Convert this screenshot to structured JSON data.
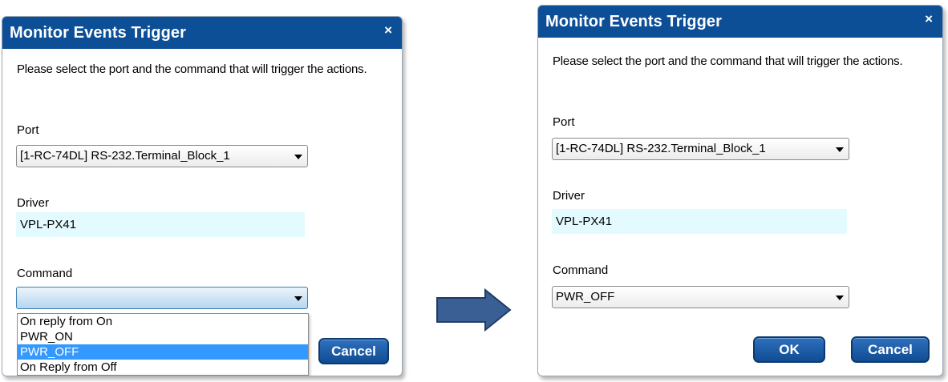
{
  "left_dialog": {
    "title": "Monitor Events Trigger",
    "close_glyph": "×",
    "description": "Please select the port and the command that will trigger the actions.",
    "port_label": "Port",
    "port_value": "[1-RC-74DL] RS-232.Terminal_Block_1",
    "driver_label": "Driver",
    "driver_value": "VPL-PX41",
    "command_label": "Command",
    "command_value": "",
    "command_options": [
      "On reply from On",
      "PWR_ON",
      "PWR_OFF",
      "On Reply from Off"
    ],
    "command_highlighted": "PWR_OFF",
    "cancel_label": "Cancel"
  },
  "right_dialog": {
    "title": "Monitor Events Trigger",
    "close_glyph": "×",
    "description": "Please select the port and the command that will trigger the actions.",
    "port_label": "Port",
    "port_value": "[1-RC-74DL] RS-232.Terminal_Block_1",
    "driver_label": "Driver",
    "driver_value": "VPL-PX41",
    "command_label": "Command",
    "command_value": "PWR_OFF",
    "ok_label": "OK",
    "cancel_label": "Cancel"
  },
  "colors": {
    "titlebar": "#0d4f97",
    "button": "#1a5aa8",
    "driver_field": "#e3fbfe",
    "highlight": "#3399ff",
    "arrow_fill": "#3a5f94"
  },
  "icons": {
    "close": "close-icon",
    "dropdown": "chevron-down-icon",
    "transition": "right-arrow-icon"
  }
}
